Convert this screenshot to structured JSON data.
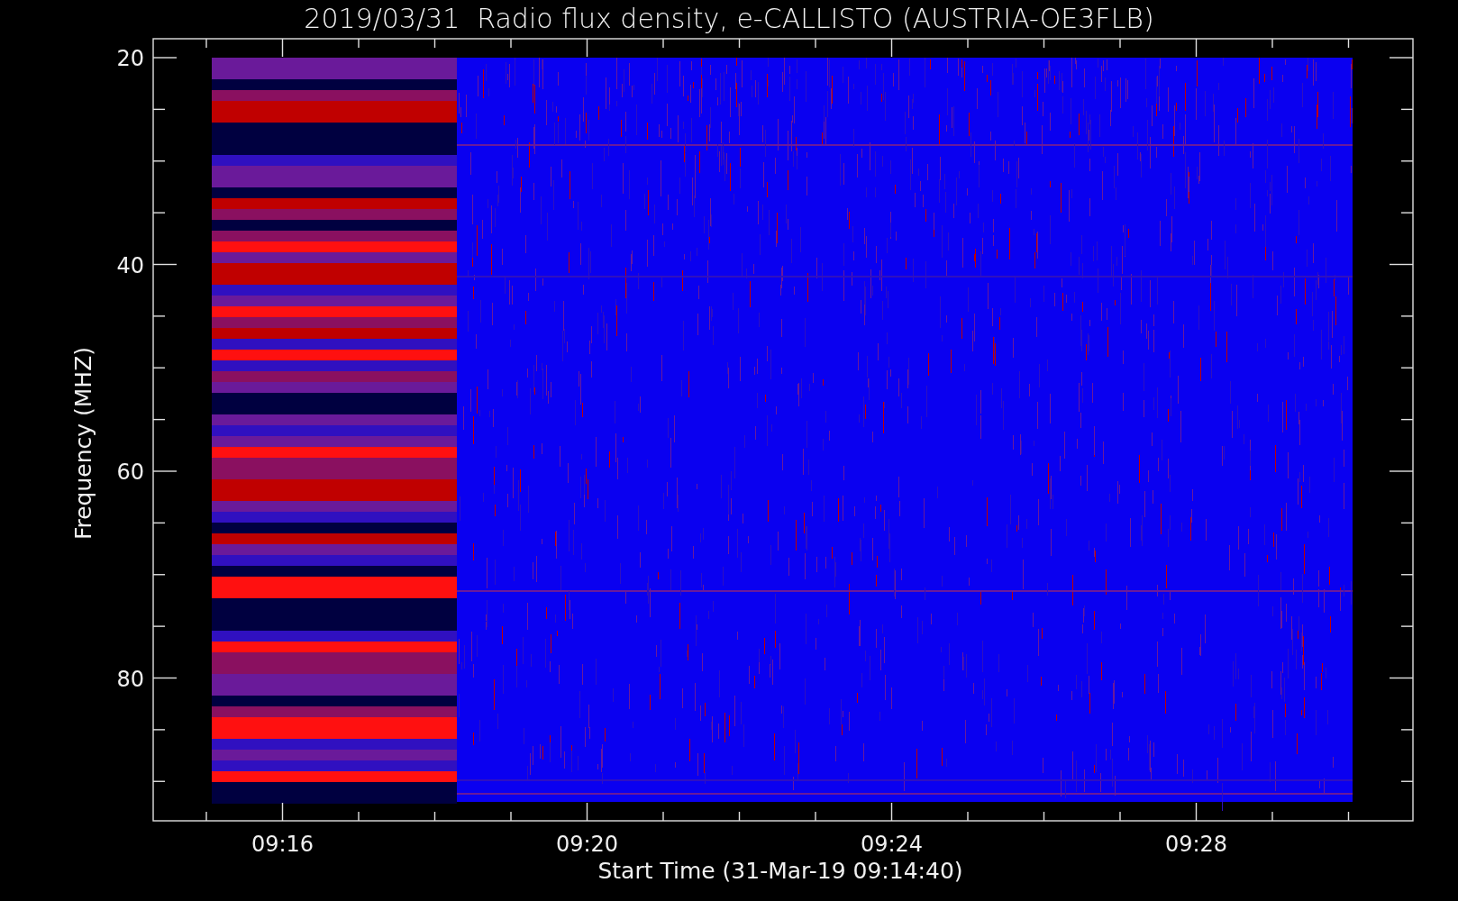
{
  "title": "2019/03/31  Radio flux density, e-CALLISTO (AUSTRIA-OE3FLB)",
  "y_axis": {
    "label": "Frequency (MHZ)",
    "ticks": [
      "20",
      "40",
      "60",
      "80"
    ]
  },
  "x_axis": {
    "label": "Start Time (31-Mar-19 09:14:40)",
    "ticks": [
      "09:16",
      "09:20",
      "09:24",
      "09:28"
    ]
  }
}
